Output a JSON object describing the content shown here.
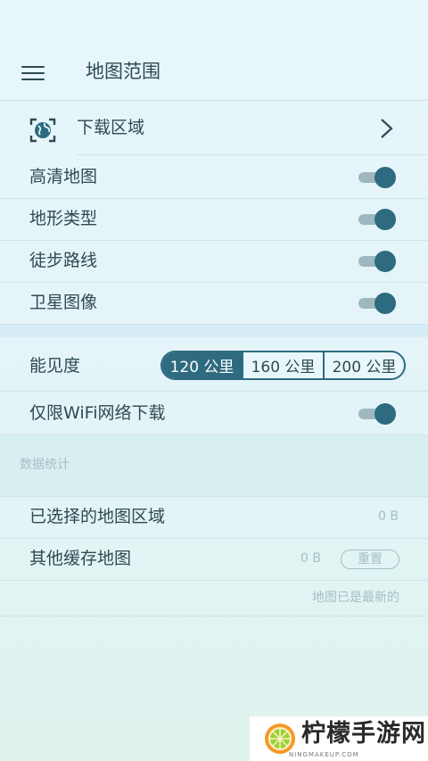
{
  "header": {
    "title": "地图范围"
  },
  "download_area": {
    "label": "下载区域"
  },
  "toggles": [
    {
      "label": "高清地图",
      "on": true
    },
    {
      "label": "地形类型",
      "on": true
    },
    {
      "label": "徒步路线",
      "on": true
    },
    {
      "label": "卫星图像",
      "on": true
    }
  ],
  "visibility": {
    "label": "能见度",
    "options": [
      "120 公里",
      "160 公里",
      "200 公里"
    ],
    "selected": "120 公里"
  },
  "wifi_only": {
    "label": "仅限WiFi网络下载",
    "on": true
  },
  "stats": {
    "header": "数据统计",
    "selected_area_label": "已选择的地图区域",
    "selected_area_value": "0 B",
    "other_cache_label": "其他缓存地图",
    "other_cache_value": "0 B",
    "reset_label": "重置",
    "status": "地图已是最新的"
  },
  "watermark": {
    "name": "柠檬手游网",
    "url": "NINGMAKEUP.COM"
  },
  "colors": {
    "accent": "#2e6b80",
    "text": "#2e4a52",
    "muted": "#a5bfc4",
    "background": "#e6f6fb"
  }
}
